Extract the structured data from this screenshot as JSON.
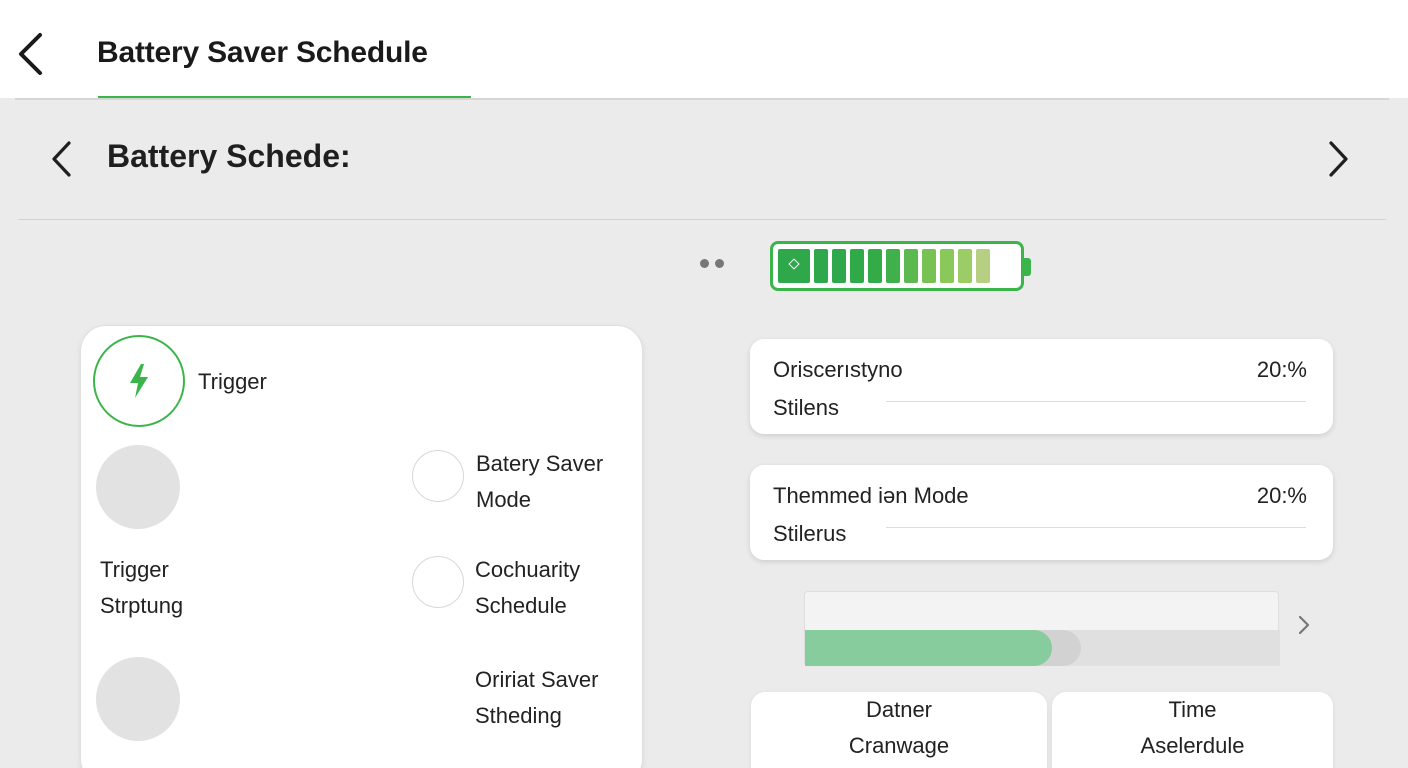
{
  "header": {
    "title": "Battery Saver Schedule",
    "back_icon": "chevron-left-icon"
  },
  "subheader": {
    "title": "Battery Schede:",
    "prev_icon": "chevron-left-icon",
    "next_icon": "chevron-right-icon"
  },
  "battery": {
    "cell_colors": [
      "#2ea84a",
      "#2ea84a",
      "#2ea84a",
      "#30aa48",
      "#33ac48",
      "#3fb04a",
      "#5bb94f",
      "#77c253",
      "#8bc85a",
      "#9ccc66",
      "#b6cf82"
    ]
  },
  "left_panel": {
    "trigger_label": "Trigger",
    "trigger_icon": "lightning-bolt-icon",
    "trigger_setup": {
      "line1": "Trigger",
      "line2": "Strptung"
    },
    "options": [
      {
        "line1": "Batery Saver",
        "line2": "Mode"
      },
      {
        "line1": "Cochuarity",
        "line2": "Schedule"
      },
      {
        "line1": "Oririat Saver",
        "line2": "Stheding"
      }
    ]
  },
  "settings": [
    {
      "name": "Oriscerıstyno",
      "value": "20:%",
      "sub": "Stilens"
    },
    {
      "name": "Themmed iən Mode",
      "value": "20:%",
      "sub": "Stilerus"
    }
  ],
  "progress": {
    "fill_percent": 52,
    "ghost_percent": 58,
    "next_icon": "chevron-right-icon"
  },
  "tiles": [
    {
      "line1": "Datner",
      "line2": "Cranwage"
    },
    {
      "line1": "Time",
      "line2": "Aselerdule"
    }
  ],
  "colors": {
    "accent": "#3bb54a",
    "progress_fill": "#86cc9c"
  }
}
